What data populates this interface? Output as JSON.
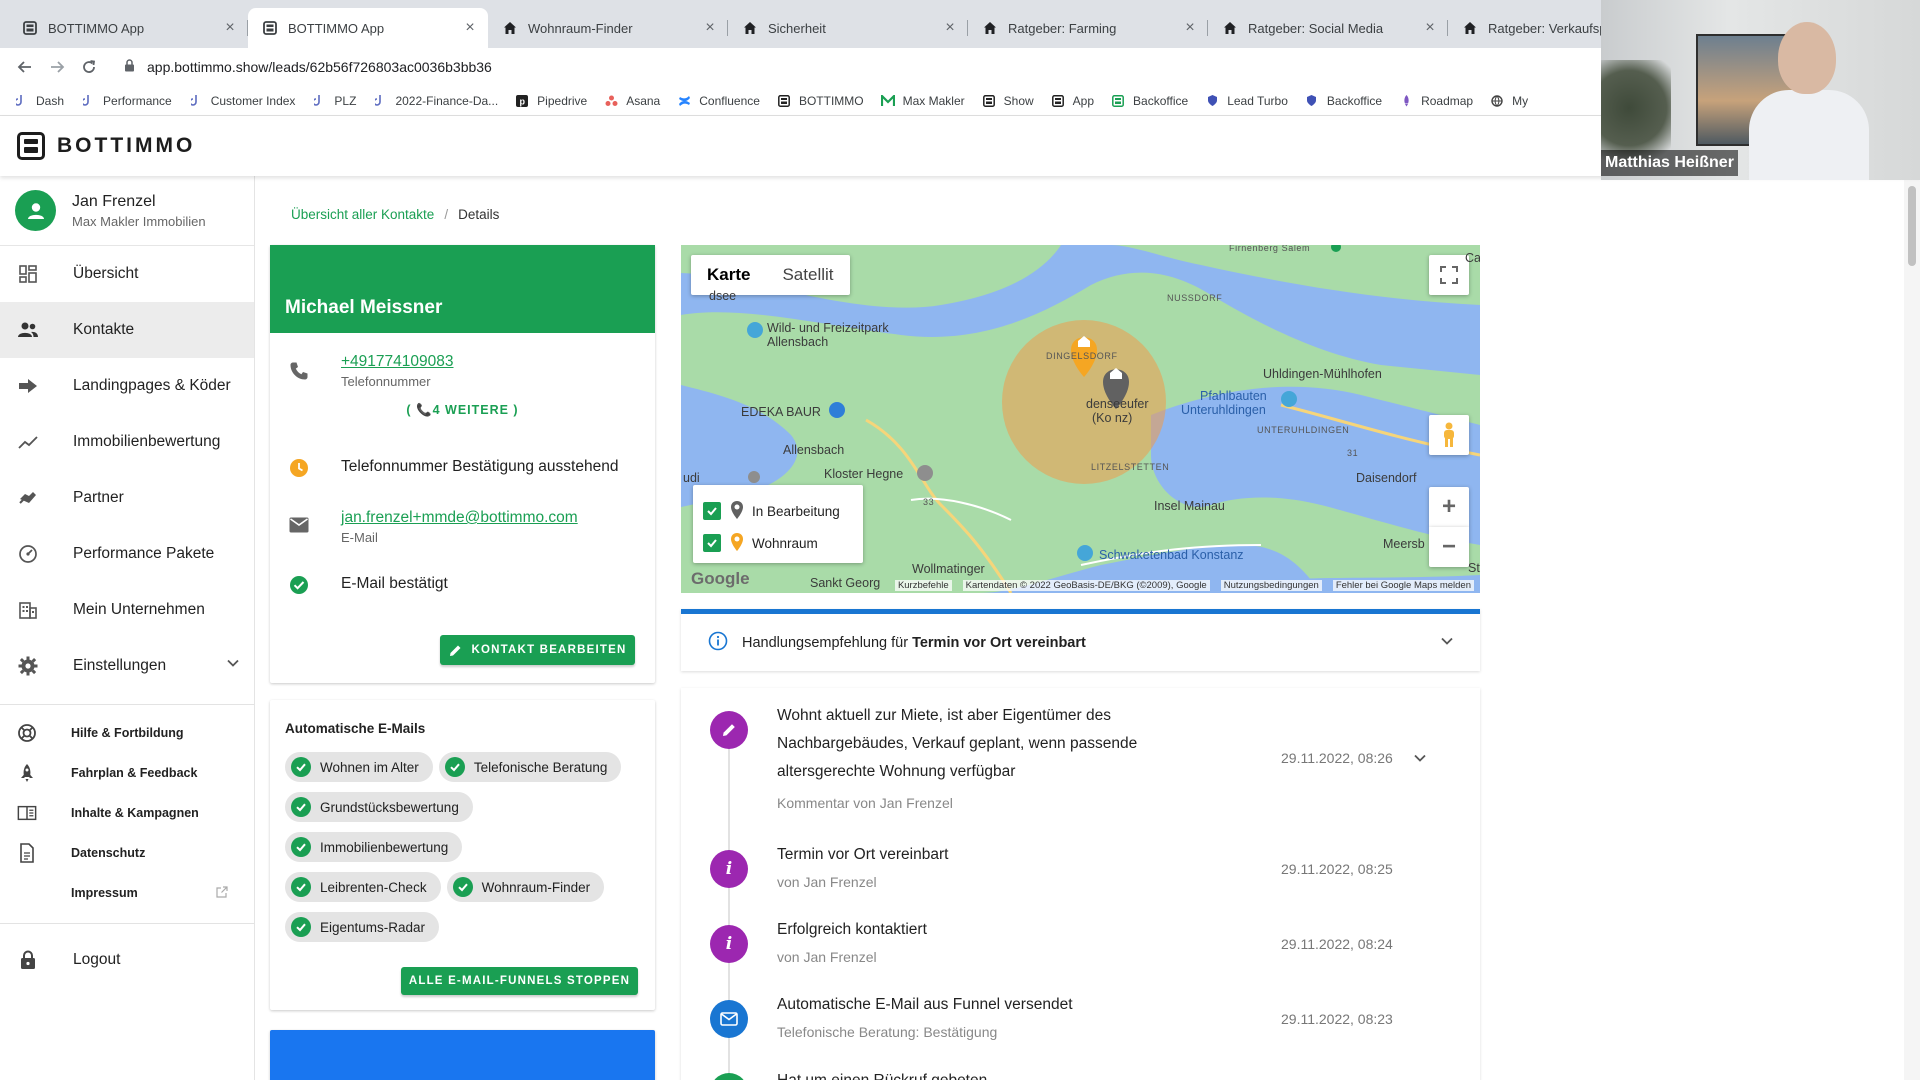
{
  "browser": {
    "tabs": [
      {
        "title": "BOTTIMMO App",
        "icon": "bottimmo-favicon",
        "active": false
      },
      {
        "title": "BOTTIMMO App",
        "icon": "bottimmo-favicon",
        "active": true
      },
      {
        "title": "Wohnraum-Finder",
        "icon": "house-icon",
        "active": false
      },
      {
        "title": "Sicherheit",
        "icon": "house-icon",
        "active": false
      },
      {
        "title": "Ratgeber: Farming",
        "icon": "house-icon",
        "active": false
      },
      {
        "title": "Ratgeber: Social Media",
        "icon": "house-icon",
        "active": false
      },
      {
        "title": "Ratgeber: Verkaufsps",
        "icon": "house-icon",
        "active": false
      }
    ],
    "close_glyph": "×",
    "url_host": "app.bottimmo.show",
    "url_path": "/leads/62b56f726803ac0036b3bb36",
    "bookmarks": [
      {
        "label": "Dash",
        "icon": "hook-icon",
        "color": "#5c6bc0"
      },
      {
        "label": "Performance",
        "icon": "hook-icon",
        "color": "#5c6bc0"
      },
      {
        "label": "Customer Index",
        "icon": "hook-icon",
        "color": "#5c6bc0"
      },
      {
        "label": "PLZ",
        "icon": "hook-icon",
        "color": "#5c6bc0"
      },
      {
        "label": "2022-Finance-Da...",
        "icon": "hook-icon",
        "color": "#5c6bc0"
      },
      {
        "label": "Pipedrive",
        "icon": "pipedrive-icon",
        "color": "#222222"
      },
      {
        "label": "Asana",
        "icon": "asana-icon",
        "color": "#e8615b"
      },
      {
        "label": "Confluence",
        "icon": "confluence-icon",
        "color": "#2684ff"
      },
      {
        "label": "BOTTIMMO",
        "icon": "bottimmo-icon",
        "color": "#222222"
      },
      {
        "label": "Max Makler",
        "icon": "m-icon",
        "color": "#1a9f53"
      },
      {
        "label": "Show",
        "icon": "bottimmo-icon",
        "color": "#222222"
      },
      {
        "label": "App",
        "icon": "bottimmo-icon",
        "color": "#222222"
      },
      {
        "label": "Backoffice",
        "icon": "bottimmo-icon",
        "color": "#1a9f53"
      },
      {
        "label": "Lead Turbo",
        "icon": "shield-icon",
        "color": "#3f51b5"
      },
      {
        "label": "Backoffice",
        "icon": "shield-icon",
        "color": "#3f51b5"
      },
      {
        "label": "Roadmap",
        "icon": "rocket-icon",
        "color": "#7e57c2"
      },
      {
        "label": "My",
        "icon": "globe-icon",
        "color": "#444444"
      }
    ]
  },
  "app": {
    "logo_text": "BOTTIMMO",
    "brand_green": "#1a9f53",
    "accent_blue": "#1976d2"
  },
  "video": {
    "name": "Matthias Heißner"
  },
  "sidebar": {
    "user_name": "Jan Frenzel",
    "user_company": "Max Makler Immobilien",
    "items": [
      {
        "label": "Übersicht",
        "icon": "dashboard-icon"
      },
      {
        "label": "Kontakte",
        "icon": "people-icon",
        "active": true
      },
      {
        "label": "Landingpages & Köder",
        "icon": "arrow-forward-icon"
      },
      {
        "label": "Immobilienbewertung",
        "icon": "trending-icon"
      },
      {
        "label": "Partner",
        "icon": "handshake-icon"
      },
      {
        "label": "Performance Pakete",
        "icon": "speedometer-icon"
      },
      {
        "label": "Mein Unternehmen",
        "icon": "building-icon"
      },
      {
        "label": "Einstellungen",
        "icon": "gear-icon",
        "expandable": true
      }
    ],
    "secondary": [
      {
        "label": "Hilfe & Fortbildung",
        "icon": "lifebuoy-icon"
      },
      {
        "label": "Fahrplan & Feedback",
        "icon": "rocket-icon"
      },
      {
        "label": "Inhalte & Kampagnen",
        "icon": "book-icon"
      },
      {
        "label": "Datenschutz",
        "icon": "document-icon"
      },
      {
        "label": "Impressum",
        "icon": "",
        "external": true
      }
    ],
    "logout": "Logout"
  },
  "breadcrumb": {
    "parent": "Übersicht aller Kontakte",
    "separator": "/",
    "current": "Details"
  },
  "contact": {
    "name": "Michael Meissner",
    "phone": "+491774109083",
    "phone_label": "Telefonnummer",
    "more": "( 📞4 WEITERE )",
    "phone_status": "Telefonnummer Bestätigung ausstehend",
    "email": "jan.frenzel+mmde@bottimmo.com",
    "email_label": "E-Mail",
    "email_status": "E-Mail bestätigt",
    "edit_button": "KONTAKT BEARBEITEN",
    "status_pending_color": "#f5a623"
  },
  "emails": {
    "title": "Automatische E-Mails",
    "chips": [
      "Wohnen im Alter",
      "Telefonische Beratung",
      "Grundstücksbewertung",
      "Immobilienbewertung",
      "Leibrenten-Check",
      "Wohnraum-Finder",
      "Eigentums-Radar"
    ],
    "stop_button": "ALLE E-MAIL-FUNNELS STOPPEN"
  },
  "map": {
    "type_map": "Karte",
    "type_satellite": "Satellit",
    "legend": [
      {
        "label": "In Bearbeitung",
        "pin_color": "#616161"
      },
      {
        "label": "Wohnraum",
        "pin_color": "#f5a623"
      }
    ],
    "labels": {
      "wild": "Wild- und Freizeitpark",
      "allensbach_park": "Allensbach",
      "edeka": "EDEKA BAUR",
      "allensbach": "Allensbach",
      "kloster": "Kloster Hegne",
      "dingelsdorf": "DINGELSDORF",
      "denseeufer": "denseeufer",
      "kn": "(Ko  nz)",
      "litzelstetten": "LITZELSTETTEN",
      "nussdorf": "NUSSDORF",
      "uhldingen": "Uhldingen-Mühlhofen",
      "pfahlbauten": "Pfahlbauten",
      "unteruhldingen_p": "Unteruhldingen",
      "unteruhldingen": "UNTERUHLDINGEN",
      "insel": "Insel Mainau",
      "daisendorf": "Daisendorf",
      "schwaketen": "Schwaketenbad Konstanz",
      "wollmatinger": "Wollmatinger",
      "sankt": "Sankt Georg",
      "meersb": "Meersb",
      "seesee": "dsee",
      "road33": "33",
      "road31": "31",
      "cal": "Cal",
      "st": "St",
      "ruzdi": "udi",
      "firnb": "Firnenberg Salem"
    },
    "google": "Google",
    "attribution": [
      "Kurzbefehle",
      "Kartendaten © 2022 GeoBasis-DE/BKG (©2009), Google",
      "Nutzungsbedingungen",
      "Fehler bei Google Maps melden"
    ],
    "land_color": "#a8d8a8",
    "water_color": "#8fb6f0"
  },
  "advice": {
    "prefix": "Handlungsempfehlung für",
    "bold": "Termin vor Ort vereinbart"
  },
  "timeline": [
    {
      "icon": "pencil-icon",
      "color": "#9c27b0",
      "title": "Wohnt aktuell zur Miete, ist aber Eigentümer des Nachbargebäudes, Verkauf geplant, wenn passende altersgerechte Wohnung verfügbar",
      "sub": "Kommentar von Jan Frenzel",
      "date": "29.11.2022, 08:26",
      "expandable": true
    },
    {
      "icon": "info-icon",
      "color": "#9c27b0",
      "title": "Termin vor Ort vereinbart",
      "sub": "von Jan Frenzel",
      "date": "29.11.2022, 08:25"
    },
    {
      "icon": "info-icon",
      "color": "#9c27b0",
      "title": "Erfolgreich kontaktiert",
      "sub": "von Jan Frenzel",
      "date": "29.11.2022, 08:24"
    },
    {
      "icon": "mail-icon",
      "color": "#1976d2",
      "title": "Automatische E-Mail aus Funnel versendet",
      "sub": "Telefonische Beratung: Bestätigung",
      "date": "29.11.2022, 08:23"
    },
    {
      "icon": "check-icon",
      "color": "#1a9f53",
      "title": "Hat um einen Rückruf gebeten",
      "sub": "",
      "date": ""
    }
  ]
}
